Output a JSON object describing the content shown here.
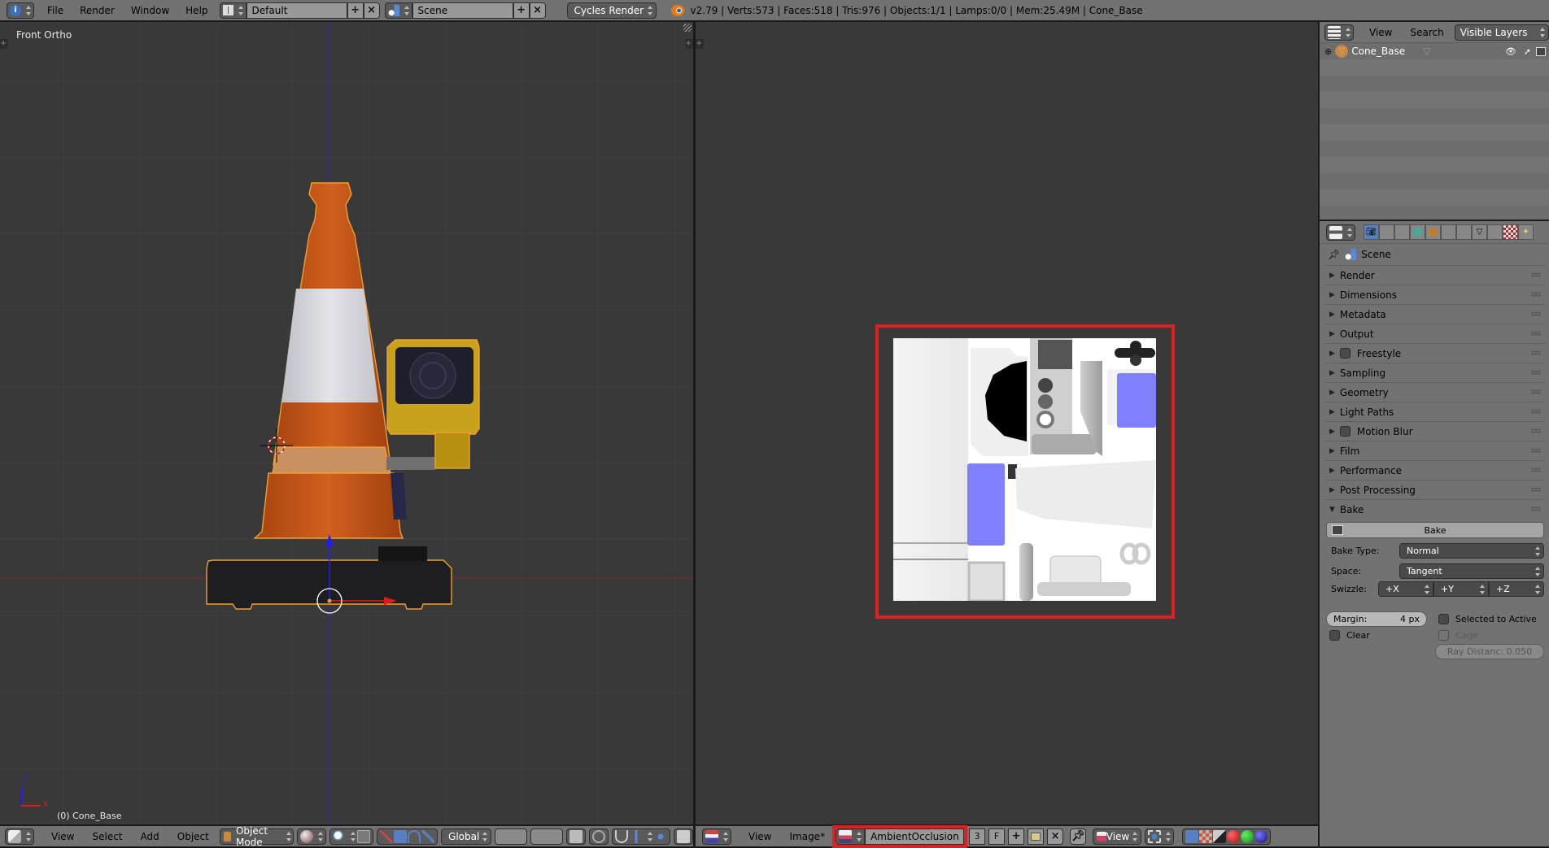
{
  "topbar": {
    "menus": [
      "File",
      "Render",
      "Window",
      "Help"
    ],
    "screen_layout": "Default",
    "scene": "Scene",
    "render_engine": "Cycles Render",
    "stats": "v2.79 | Verts:573 | Faces:518 | Tris:976 | Objects:1/1 | Lamps:0/0 | Mem:25.49M | Cone_Base",
    "icons": [
      "info-icon",
      "screen-layout-icon",
      "scene-icon",
      "blender-logo-icon"
    ]
  },
  "view3d": {
    "view_name": "Front Ortho",
    "object_label": "(0) Cone_Base",
    "axis_labels": {
      "z": "Z",
      "x": "X"
    },
    "header": {
      "menus": [
        "View",
        "Select",
        "Add",
        "Object"
      ],
      "mode": "Object Mode",
      "orientation": "Global"
    },
    "colors": {
      "x_axis": "#c81e1e",
      "z_axis": "#1e1ec8",
      "selection_outline": "#f0a030",
      "cone_orange": "#c8561a"
    }
  },
  "image_editor": {
    "header": {
      "menus": [
        "View",
        "Image*"
      ],
      "image_name": "AmbientOcclusion",
      "users_count": "3",
      "fake_user": "F",
      "view_mode": "View"
    },
    "highlight_color": "#e02020"
  },
  "outliner": {
    "menus": [
      "View",
      "Search"
    ],
    "filter": "Visible Layers",
    "items": [
      {
        "name": "Cone_Base"
      }
    ]
  },
  "properties": {
    "context": "Scene",
    "panels": [
      {
        "label": "Render",
        "expanded": false,
        "checkbox": false
      },
      {
        "label": "Dimensions",
        "expanded": false,
        "checkbox": false
      },
      {
        "label": "Metadata",
        "expanded": false,
        "checkbox": false
      },
      {
        "label": "Output",
        "expanded": false,
        "checkbox": false
      },
      {
        "label": "Freestyle",
        "expanded": false,
        "checkbox": true
      },
      {
        "label": "Sampling",
        "expanded": false,
        "checkbox": false
      },
      {
        "label": "Geometry",
        "expanded": false,
        "checkbox": false
      },
      {
        "label": "Light Paths",
        "expanded": false,
        "checkbox": false
      },
      {
        "label": "Motion Blur",
        "expanded": false,
        "checkbox": true
      },
      {
        "label": "Film",
        "expanded": false,
        "checkbox": false
      },
      {
        "label": "Performance",
        "expanded": false,
        "checkbox": false
      },
      {
        "label": "Post Processing",
        "expanded": false,
        "checkbox": false
      },
      {
        "label": "Bake",
        "expanded": true,
        "checkbox": false
      }
    ],
    "bake": {
      "bake_button": "Bake",
      "bake_type_label": "Bake Type:",
      "bake_type": "Normal",
      "space_label": "Space:",
      "space": "Tangent",
      "swizzle_label": "Swizzle:",
      "swizzle": [
        "+X",
        "+Y",
        "+Z"
      ],
      "margin_label": "Margin:",
      "margin_value": "4 px",
      "selected_to_active": "Selected to Active",
      "clear": "Clear",
      "cage": "Cage",
      "ray_distance": "Ray Distanc: 0.050"
    }
  }
}
